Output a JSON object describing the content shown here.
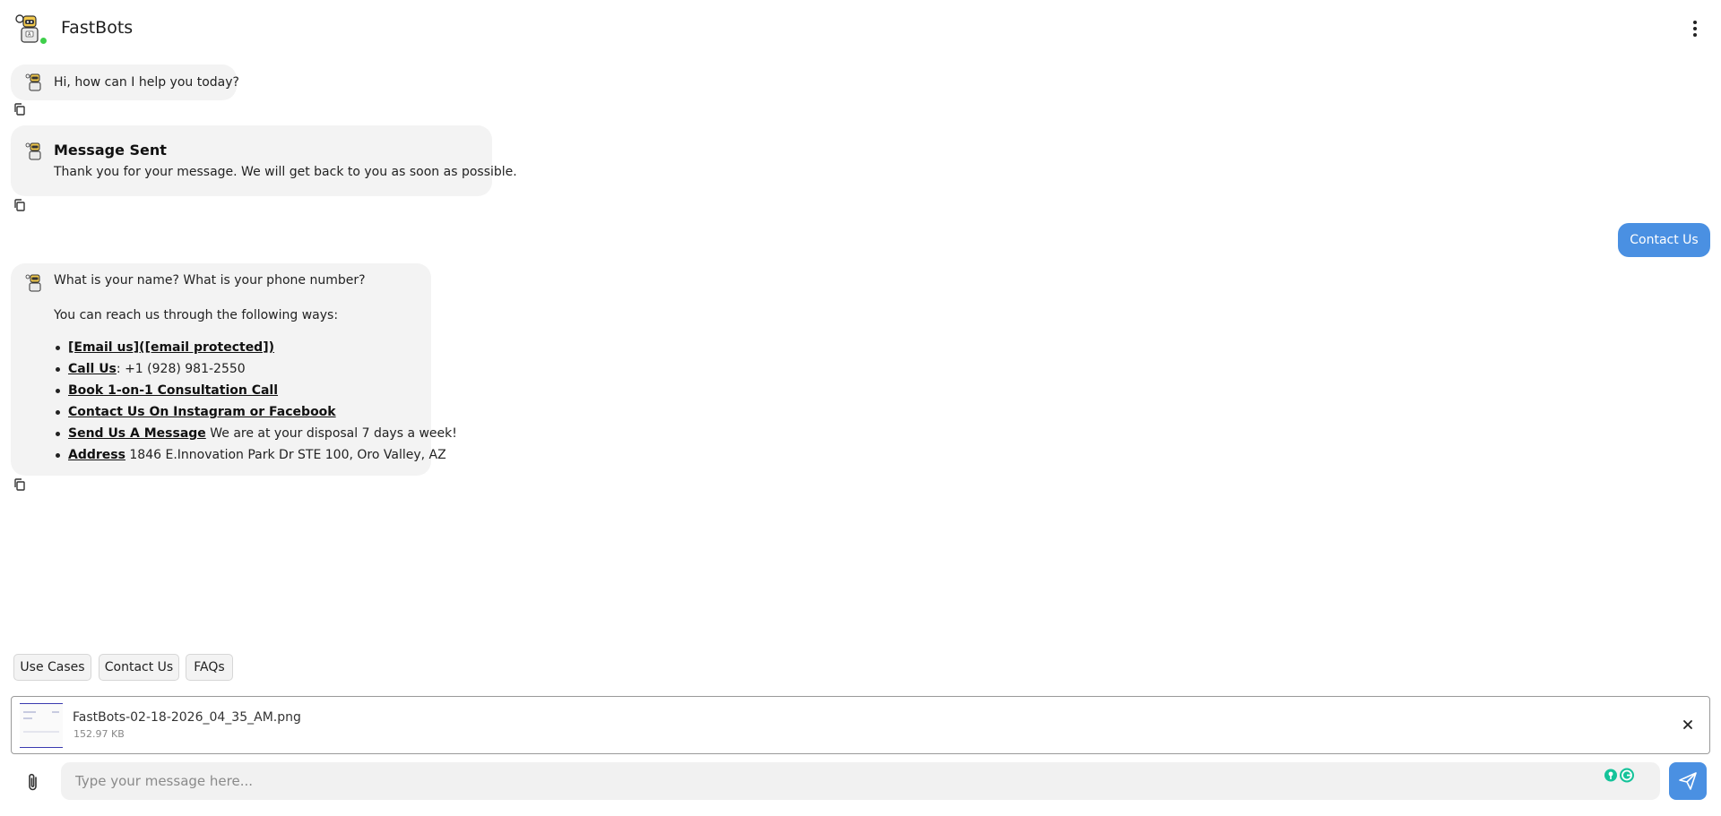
{
  "header": {
    "title": "FastBots",
    "status": "online"
  },
  "messages": {
    "greeting": "Hi, how can I help you today?",
    "sent_title": "Message Sent",
    "sent_text": "Thank you for your message. We will get back to you as soon as possible.",
    "user_message": "Contact Us",
    "question": "What is your name? What is your phone number?",
    "intro": "You can reach us through the following ways:",
    "contact_items": [
      {
        "label": "[Email us]([email protected])",
        "text": ""
      },
      {
        "label": "Call Us",
        "text": ": +1 (928) 981-2550"
      },
      {
        "label": "Book 1-on-1 Consultation Call",
        "text": ""
      },
      {
        "label": "Contact Us On Instagram or Facebook",
        "text": ""
      },
      {
        "label": "Send Us A Message",
        "text": " We are at your disposal 7 days a week!"
      },
      {
        "label": "Address",
        "text": " 1846 E.Innovation Park Dr STE 100, Oro Valley, AZ"
      }
    ]
  },
  "quick_replies": [
    "Use Cases",
    "Contact Us",
    "FAQs"
  ],
  "attachment": {
    "file_name": "FastBots-02-18-2026_04_35_AM.png",
    "file_size": "152.97 KB"
  },
  "composer": {
    "placeholder": "Type your message here...",
    "value": ""
  },
  "icons": {
    "menu": "kebab-menu-icon",
    "copy": "copy-icon",
    "attach": "paperclip-icon",
    "send": "send-icon",
    "remove": "close-icon"
  },
  "colors": {
    "accent": "#4a90e2",
    "bot_bubble": "#f3f3f3",
    "online": "#3ecf4a"
  }
}
